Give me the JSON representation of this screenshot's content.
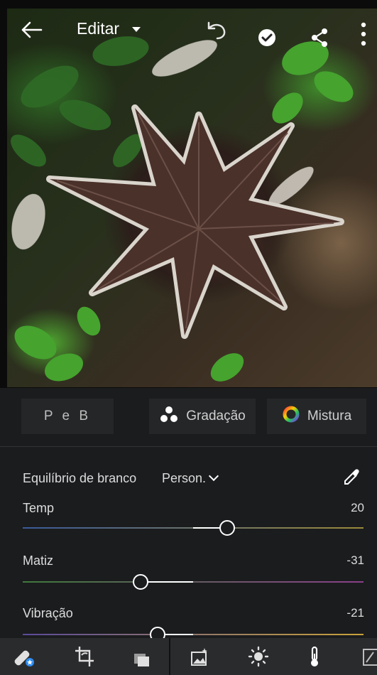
{
  "header": {
    "title": "Editar",
    "icons": {
      "back": "arrow-left-icon",
      "menu": "caret-down-icon",
      "undo": "undo-icon",
      "done": "check-circle-icon",
      "share": "share-icon",
      "more": "more-vertical-icon"
    }
  },
  "tabs": {
    "bw": "P e B",
    "grading": "Gradação",
    "mix": "Mistura"
  },
  "white_balance": {
    "label": "Equilíbrio de branco",
    "value": "Person."
  },
  "sliders": [
    {
      "label": "Temp",
      "value": "20",
      "position": 0.6,
      "fill_from": 0.5,
      "colors": [
        "#3a5b9a",
        "#9a8a3a"
      ]
    },
    {
      "label": "Matiz",
      "value": "-31",
      "position": 0.345,
      "fill_from": 0.5,
      "colors": [
        "#3f7a3a",
        "#8a3f8a"
      ]
    },
    {
      "label": "Vibração",
      "value": "-21",
      "position": 0.395,
      "fill_from": 0.5,
      "colors": [
        "#5a4a9a",
        "#c8a23a"
      ]
    }
  ],
  "bottom_toolbar": [
    "healing-brush-icon",
    "crop-icon",
    "versions-icon",
    "presets-icon",
    "light-icon",
    "color-thermometer-icon",
    "optics-icon"
  ],
  "accent": "#2d8cf0"
}
